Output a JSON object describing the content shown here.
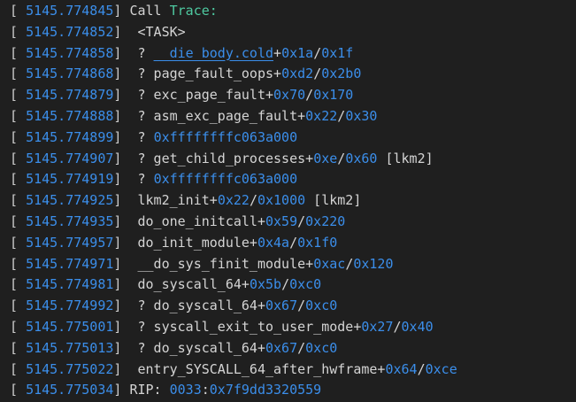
{
  "colors": {
    "background": "#1f1f1f",
    "text": "#d4d4d4",
    "timestamp": "#3b8eea",
    "hex": "#3b8eea",
    "trace_green": "#4ec9a0"
  },
  "lines": [
    {
      "ts": "5145.774845",
      "parts": [
        {
          "t": "Call "
        },
        {
          "t": "Trace:",
          "c": "green"
        }
      ]
    },
    {
      "ts": "5145.774852",
      "parts": [
        {
          "t": " <TASK>"
        }
      ]
    },
    {
      "ts": "5145.774858",
      "parts": [
        {
          "t": " ? "
        },
        {
          "t": "__die_body.cold",
          "c": "num",
          "u": true
        },
        {
          "t": "+"
        },
        {
          "t": "0x1a",
          "c": "num"
        },
        {
          "t": "/"
        },
        {
          "t": "0x1f",
          "c": "num"
        }
      ]
    },
    {
      "ts": "5145.774868",
      "parts": [
        {
          "t": " ? page_fault_oops+"
        },
        {
          "t": "0xd2",
          "c": "num"
        },
        {
          "t": "/"
        },
        {
          "t": "0x2b0",
          "c": "num"
        }
      ]
    },
    {
      "ts": "5145.774879",
      "parts": [
        {
          "t": " ? exc_page_fault+"
        },
        {
          "t": "0x70",
          "c": "num"
        },
        {
          "t": "/"
        },
        {
          "t": "0x170",
          "c": "num"
        }
      ]
    },
    {
      "ts": "5145.774888",
      "parts": [
        {
          "t": " ? asm_exc_page_fault+"
        },
        {
          "t": "0x22",
          "c": "num"
        },
        {
          "t": "/"
        },
        {
          "t": "0x30",
          "c": "num"
        }
      ]
    },
    {
      "ts": "5145.774899",
      "parts": [
        {
          "t": " ? "
        },
        {
          "t": "0xffffffffc063a000",
          "c": "num"
        }
      ]
    },
    {
      "ts": "5145.774907",
      "parts": [
        {
          "t": " ? get_child_processes+"
        },
        {
          "t": "0xe",
          "c": "num"
        },
        {
          "t": "/"
        },
        {
          "t": "0x60",
          "c": "num"
        },
        {
          "t": " [lkm2]"
        }
      ]
    },
    {
      "ts": "5145.774919",
      "parts": [
        {
          "t": " ? "
        },
        {
          "t": "0xffffffffc063a000",
          "c": "num"
        }
      ]
    },
    {
      "ts": "5145.774925",
      "parts": [
        {
          "t": " lkm2_init+"
        },
        {
          "t": "0x22",
          "c": "num"
        },
        {
          "t": "/"
        },
        {
          "t": "0x1000",
          "c": "num"
        },
        {
          "t": " [lkm2]"
        }
      ]
    },
    {
      "ts": "5145.774935",
      "parts": [
        {
          "t": " do_one_initcall+"
        },
        {
          "t": "0x59",
          "c": "num"
        },
        {
          "t": "/"
        },
        {
          "t": "0x220",
          "c": "num"
        }
      ]
    },
    {
      "ts": "5145.774957",
      "parts": [
        {
          "t": " do_init_module+"
        },
        {
          "t": "0x4a",
          "c": "num"
        },
        {
          "t": "/"
        },
        {
          "t": "0x1f0",
          "c": "num"
        }
      ]
    },
    {
      "ts": "5145.774971",
      "parts": [
        {
          "t": " __do_sys_finit_module+"
        },
        {
          "t": "0xac",
          "c": "num"
        },
        {
          "t": "/"
        },
        {
          "t": "0x120",
          "c": "num"
        }
      ]
    },
    {
      "ts": "5145.774981",
      "parts": [
        {
          "t": " do_syscall_64+"
        },
        {
          "t": "0x5b",
          "c": "num"
        },
        {
          "t": "/"
        },
        {
          "t": "0xc0",
          "c": "num"
        }
      ]
    },
    {
      "ts": "5145.774992",
      "parts": [
        {
          "t": " ? do_syscall_64+"
        },
        {
          "t": "0x67",
          "c": "num"
        },
        {
          "t": "/"
        },
        {
          "t": "0xc0",
          "c": "num"
        }
      ]
    },
    {
      "ts": "5145.775001",
      "parts": [
        {
          "t": " ? syscall_exit_to_user_mode+"
        },
        {
          "t": "0x27",
          "c": "num"
        },
        {
          "t": "/"
        },
        {
          "t": "0x40",
          "c": "num"
        }
      ]
    },
    {
      "ts": "5145.775013",
      "parts": [
        {
          "t": " ? do_syscall_64+"
        },
        {
          "t": "0x67",
          "c": "num"
        },
        {
          "t": "/"
        },
        {
          "t": "0xc0",
          "c": "num"
        }
      ]
    },
    {
      "ts": "5145.775022",
      "parts": [
        {
          "t": " entry_SYSCALL_64_after_hwframe+"
        },
        {
          "t": "0x64",
          "c": "num"
        },
        {
          "t": "/"
        },
        {
          "t": "0xce",
          "c": "num"
        }
      ]
    },
    {
      "ts": "5145.775034",
      "parts": [
        {
          "t": "RIP: "
        },
        {
          "t": "0033",
          "c": "num"
        },
        {
          "t": ":"
        },
        {
          "t": "0x7f9dd3320559",
          "c": "num"
        }
      ]
    }
  ]
}
